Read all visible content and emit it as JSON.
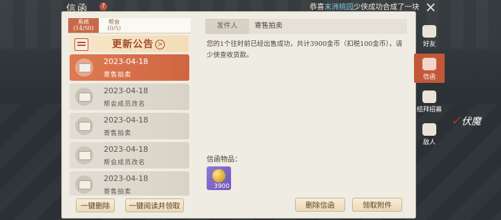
{
  "window": {
    "title": "信函"
  },
  "ticker": {
    "prefix": "恭喜",
    "highlight": "末洲桃园",
    "suffix": "少侠成功合成了一块"
  },
  "tabs": [
    {
      "label": "系统",
      "count": "(14/50)"
    },
    {
      "label": "帮会",
      "count": "(0/5)"
    }
  ],
  "announcement": {
    "label": "更新公告"
  },
  "mails": [
    {
      "date": "2023-04-18",
      "subject": "寄售拍卖"
    },
    {
      "date": "2023-04-18",
      "subject": "帮会成员改名"
    },
    {
      "date": "2023-04-18",
      "subject": "寄售拍卖"
    },
    {
      "date": "2023-04-18",
      "subject": "帮会成员改名"
    },
    {
      "date": "2023-04-18",
      "subject": "寄售拍卖"
    }
  ],
  "left_buttons": {
    "delete_all": "一键删除",
    "read_all": "一键阅读并领取"
  },
  "detail": {
    "sender_label": "发件人",
    "sender_value": "寄售拍卖",
    "body": "您的1个往时前已经出售成功，共计3900金币（扣税100金币），请少侠查收货款。",
    "items_label": "信函物品：",
    "item": {
      "icon": "gold-coin-icon",
      "qty": "3900"
    }
  },
  "right_buttons": {
    "delete": "删除信函",
    "claim": "领取附件"
  },
  "sidebar": [
    {
      "label": "好友",
      "icon": "friends-icon"
    },
    {
      "label": "信函",
      "icon": "mail-icon"
    },
    {
      "label": "结拜招募",
      "icon": "sworn-recruit-icon"
    },
    {
      "label": "敌人",
      "icon": "enemy-icon"
    }
  ],
  "deco": {
    "brush": "伏魔"
  }
}
